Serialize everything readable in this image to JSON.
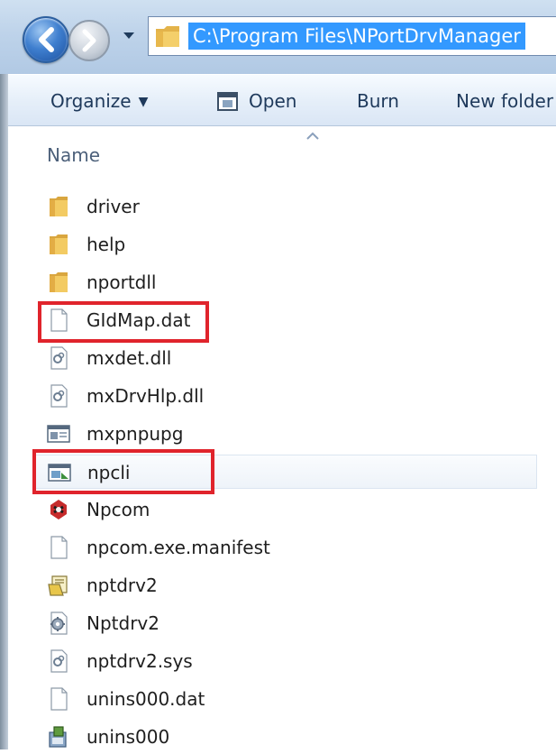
{
  "navigation": {
    "address_path": "C:\\Program Files\\NPortDrvManager"
  },
  "toolbar": {
    "organize_label": "Organize",
    "open_label": "Open",
    "burn_label": "Burn",
    "new_folder_label": "New folder"
  },
  "columns": {
    "name_header": "Name"
  },
  "files": [
    {
      "name": "driver",
      "icon": "folder-icon"
    },
    {
      "name": "help",
      "icon": "folder-icon"
    },
    {
      "name": "nportdll",
      "icon": "folder-icon"
    },
    {
      "name": "GIdMap.dat",
      "icon": "blank-file-icon",
      "highlighted": true
    },
    {
      "name": "mxdet.dll",
      "icon": "dll-file-icon"
    },
    {
      "name": "mxDrvHlp.dll",
      "icon": "dll-file-icon"
    },
    {
      "name": "mxpnpupg",
      "icon": "application-icon"
    },
    {
      "name": "npcli",
      "icon": "application-icon",
      "highlighted": true,
      "hovered": true
    },
    {
      "name": "Npcom",
      "icon": "npcom-app-icon"
    },
    {
      "name": "npcom.exe.manifest",
      "icon": "blank-file-icon"
    },
    {
      "name": "nptdrv2",
      "icon": "setup-info-icon"
    },
    {
      "name": "Nptdrv2",
      "icon": "config-gear-icon"
    },
    {
      "name": "nptdrv2.sys",
      "icon": "dll-file-icon"
    },
    {
      "name": "unins000.dat",
      "icon": "blank-file-icon"
    },
    {
      "name": "unins000",
      "icon": "uninstaller-icon"
    }
  ],
  "colors": {
    "highlight_box": "#e0242c",
    "address_selection": "#3399ff"
  }
}
